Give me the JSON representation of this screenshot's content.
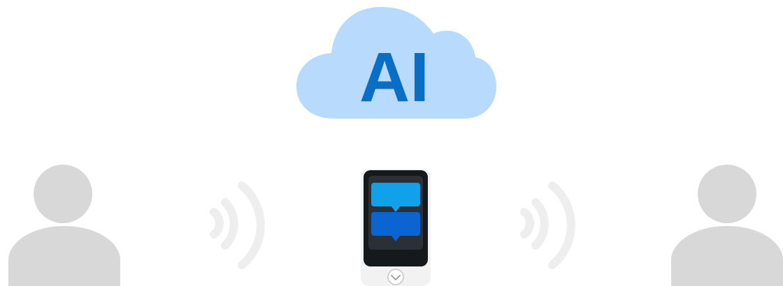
{
  "cloud": {
    "label": "AI",
    "fill_color": "#b8dafc",
    "text_color": "#0a6ec4"
  },
  "people": {
    "left_icon": "person-icon",
    "right_icon": "person-icon",
    "color": "#d8d8d8"
  },
  "signals": {
    "left_icon": "sound-waves-icon",
    "right_icon": "sound-waves-icon",
    "color": "#eeeeee"
  },
  "device": {
    "icon": "translator-device-icon",
    "body_color": "#f2f2f2",
    "screen_color": "#15191c",
    "top_bubble_color": "#11a0ea",
    "bottom_bubble_color": "#0a64d2",
    "button_icon": "chevron-down-icon"
  }
}
